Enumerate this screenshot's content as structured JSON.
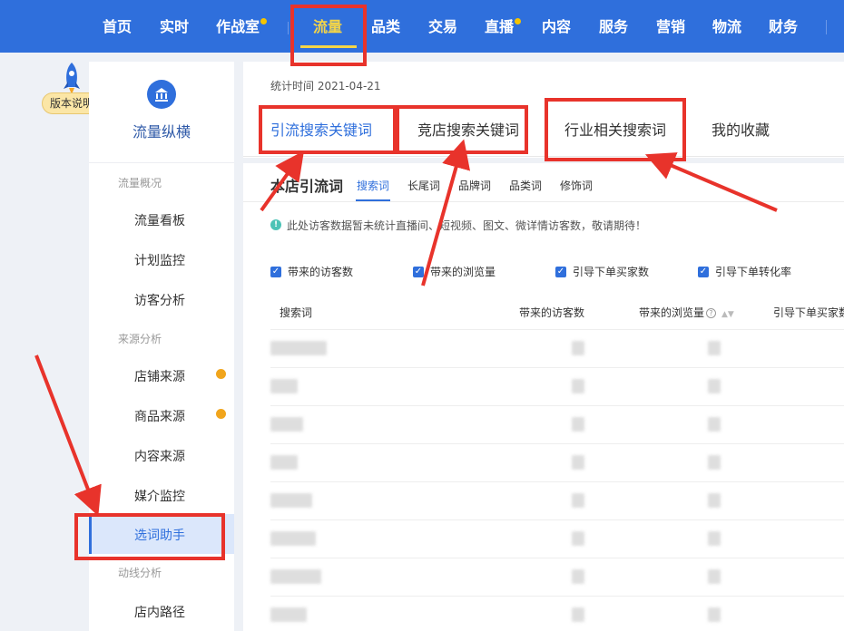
{
  "nav": {
    "items": [
      "首页",
      "实时",
      "作战室",
      "流量",
      "品类",
      "交易",
      "直播",
      "内容",
      "服务",
      "营销",
      "物流",
      "财务"
    ],
    "active": "流量"
  },
  "badge": {
    "label": "版本说明"
  },
  "sidebar": {
    "brand": "流量纵横",
    "groups": [
      {
        "title": "流量概况",
        "items": [
          "流量看板",
          "计划监控",
          "访客分析"
        ]
      },
      {
        "title": "来源分析",
        "items": [
          "店铺来源",
          "商品来源",
          "内容来源",
          "媒介监控",
          "选词助手"
        ]
      },
      {
        "title": "动线分析",
        "items": [
          "店内路径"
        ]
      }
    ],
    "active_item": "选词助手"
  },
  "main": {
    "stat_time": "统计时间 2021-04-21",
    "tabs": [
      "引流搜索关键词",
      "竞店搜索关键词",
      "行业相关搜索词",
      "我的收藏"
    ],
    "active_tab": "引流搜索关键词",
    "section_title": "本店引流词",
    "sub_tabs": [
      "搜索词",
      "长尾词",
      "品牌词",
      "品类词",
      "修饰词"
    ],
    "active_sub_tab": "搜索词",
    "notice": "此处访客数据暂未统计直播间、短视频、图文、微详情访客数，敬请期待！",
    "checkboxes": [
      "带来的访客数",
      "带来的浏览量",
      "引导下单买家数",
      "引导下单转化率"
    ],
    "table_headers": [
      "搜索词",
      "带来的访客数",
      "带来的浏览量",
      "引导下单买家数"
    ]
  },
  "colors": {
    "primary": "#2f6fdc",
    "highlight": "#f5d547",
    "annotation": "#e8332b",
    "dot": "#f1a51c"
  }
}
